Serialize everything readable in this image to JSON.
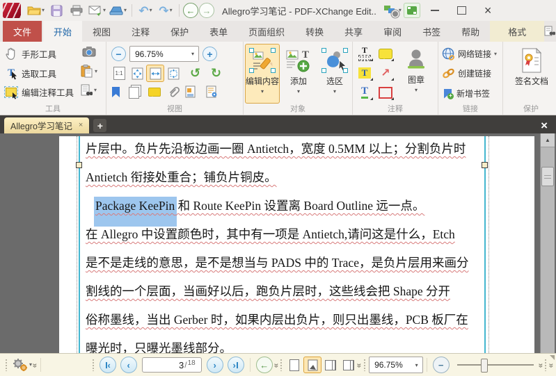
{
  "titlebar": {
    "title": "Allegro学习笔记 - PDF-XChange Edit.."
  },
  "ribbon_tabs": [
    "文件",
    "开始",
    "视图",
    "注释",
    "保护",
    "表单",
    "页面组织",
    "转换",
    "共享",
    "审阅",
    "书签",
    "帮助",
    "格式"
  ],
  "ribbon": {
    "tools": {
      "group_label": "工具",
      "hand": "手形工具",
      "select": "选取工具",
      "edit_comment": "编辑注释工具"
    },
    "view": {
      "group_label": "视图",
      "zoom_value": "96.75%",
      "actual_size": "1:1"
    },
    "object": {
      "group_label": "对象",
      "edit_content": "编辑内容",
      "add": "添加",
      "selection": "选区"
    },
    "comment": {
      "group_label": "注释",
      "stamp": "图章"
    },
    "links": {
      "group_label": "链接",
      "web_links": "网络链接",
      "create_link": "创建链接",
      "add_bookmark": "新增书签"
    },
    "protect": {
      "group_label": "保护",
      "sign_doc": "签名文档"
    }
  },
  "doc_tabs": {
    "active_label": "Allegro学习笔记"
  },
  "document": {
    "l1": "片层中。负片先沿板边画一圈 Antietch，宽度 0.5MM 以上；分割负片时",
    "l2": "Antietch 衔接处重合；铺负片铜皮。",
    "l3_hl": "Package KeePin",
    "l3_rest": " 和 Route KeePin 设置离 Board Outline 远一点。",
    "l4": "在 Allegro 中设置颜色时，其中有一项是 Antietch,请问这是什么，Etch",
    "l5": "是不是走线的意思，是不是想当与 PADS 中的 Trace，是负片层用来画分",
    "l6": "割线的一个层面，当画好以后，跑负片层时，这些线会把 Shape 分开",
    "l7": "俗称墨线，当出 Gerber 时，如果内层出负片，则只出墨线，PCB 板厂在",
    "l8": "曝光时，只曝光墨线部分。"
  },
  "statusbar": {
    "page_current": "3",
    "page_separator": "/",
    "page_total": "18",
    "zoom_value": "96.75%"
  },
  "icons": {
    "dropdown": "▾",
    "undo": "↶",
    "redo": "↷",
    "back": "←",
    "forward": "→",
    "close": "×",
    "plus": "+",
    "zoom_in": "+",
    "zoom_out": "−",
    "rotate_left": "↺",
    "rotate_right": "↻",
    "scroll_up": "▲",
    "chevrons": "»",
    "nav_prev": "‹",
    "nav_next": "›",
    "annot_arrow": "↗",
    "letter_t": "T"
  },
  "colors": {
    "file_tab_red": "#c0504a",
    "active_tab_blue": "#1f66a8",
    "selected_tool_bg": "#fdeabb",
    "selected_tool_border": "#d9a648",
    "doc_tab_gradient": "#fdf0c4",
    "text_selection_blue": "#9dc6ee",
    "content_box_cyan": "#44b6cf",
    "squiggle_red": "#d87b7b",
    "statusbar_cream": "#f8f5e4"
  }
}
